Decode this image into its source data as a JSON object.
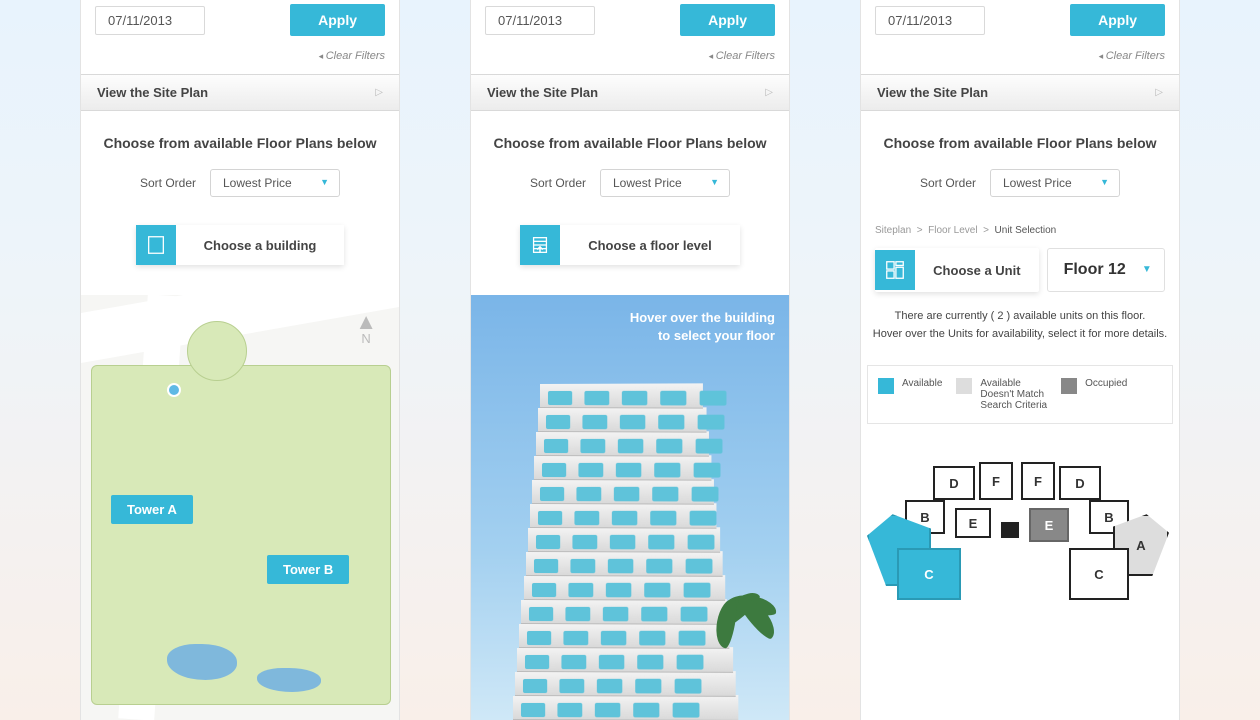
{
  "filter": {
    "date": "07/11/2013",
    "apply": "Apply",
    "clear": "Clear Filters"
  },
  "accordion": {
    "title": "View the Site Plan"
  },
  "heading": "Choose from available Floor Plans below",
  "sort": {
    "label": "Sort Order",
    "value": "Lowest Price"
  },
  "panel1": {
    "pick": "Choose a building",
    "towerA": "Tower A",
    "towerB": "Tower B",
    "compass": "N"
  },
  "panel2": {
    "pick": "Choose a floor level",
    "hover1": "Hover over the building",
    "hover2": "to select your floor"
  },
  "panel3": {
    "pick": "Choose a Unit",
    "floor": "Floor 12",
    "crumbs": {
      "a": "Siteplan",
      "b": "Floor Level",
      "c": "Unit Selection",
      "sep": ">"
    },
    "avail1": "There are currently  ( 2 ) available units on this floor.",
    "avail2": "Hover over the Units for availability, select it for more details.",
    "legend": {
      "avail": "Available",
      "partial": "Available\nDoesn't Match\nSearch Criteria",
      "occ": "Occupied"
    },
    "units": {
      "A": "A",
      "B": "B",
      "C": "C",
      "D": "D",
      "E": "E",
      "F": "F"
    }
  }
}
